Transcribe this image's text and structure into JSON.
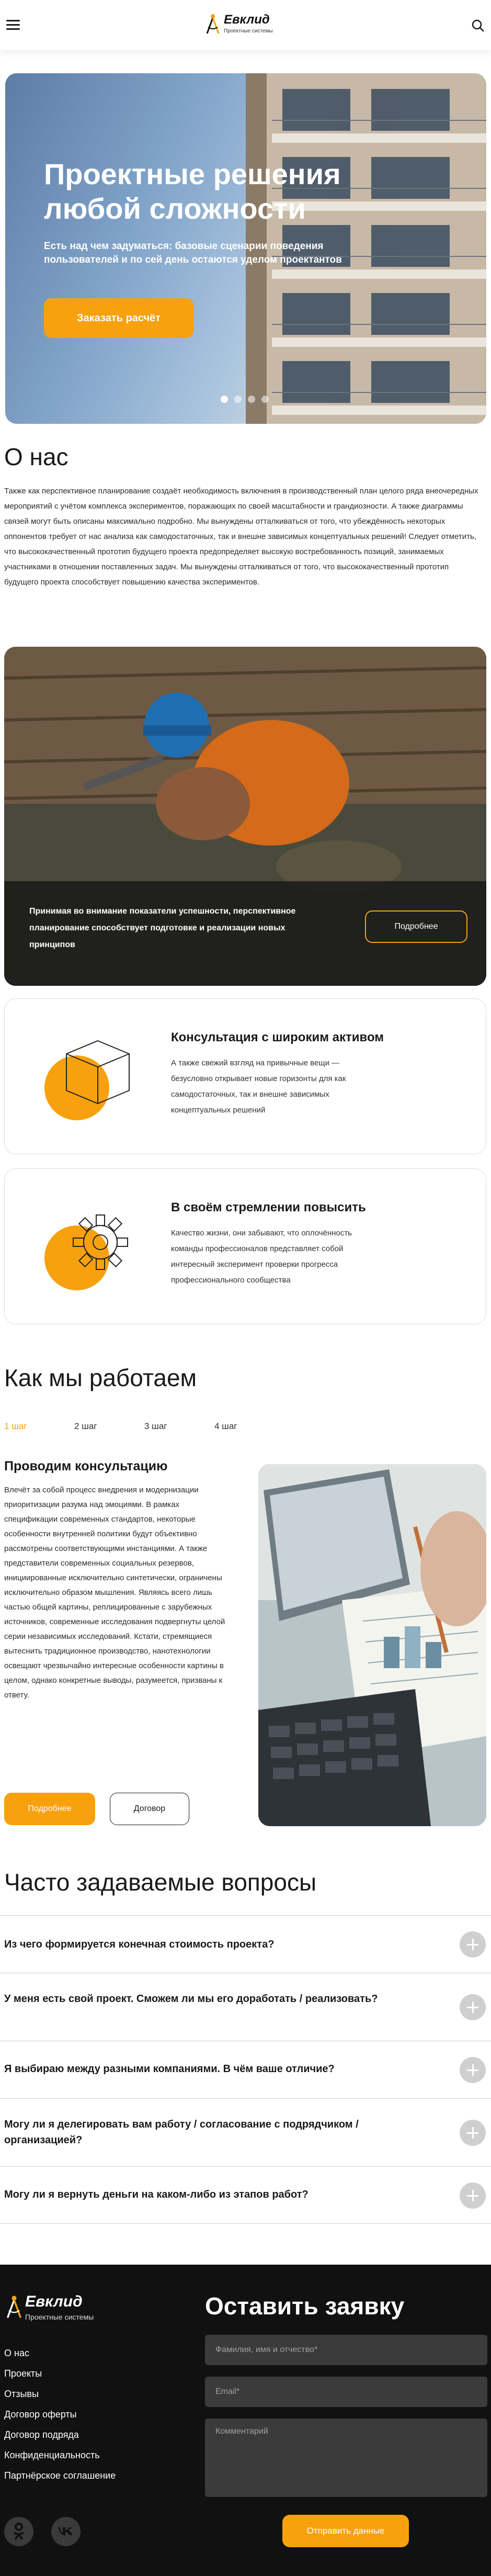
{
  "header": {
    "logo_name": "Евклид",
    "logo_sub": "Проектные системы"
  },
  "hero": {
    "title": "Проектные решения любой сложности",
    "subtitle": "Есть над чем задуматься: базовые сценарии поведения пользователей и по сей день остаются уделом проектантов",
    "button": "Заказать расчёт",
    "slides_count": 4,
    "active_slide": 1
  },
  "about": {
    "title": "О нас",
    "text": "Также как перспективное планирование создаёт необходимость включения в производственный план целого ряда внеочередных мероприятий с учётом комплекса экспериментов, поражающих по своей масштабности и грандиозности. А также диаграммы связей могут быть описаны максимально подробно. Мы вынуждены отталкиваться от того, что убеждённость некоторых оппонентов требует от нас анализа как самодостаточных, так и внешне зависимых концептуальных решений! Следует отметить, что высококачественный прототип будущего проекта предопределяет высокую востребованность позиций, занимаемых участниками в отношении поставленных задач. Мы вынуждены отталкиваться от того, что высококачественный прототип будущего проекта способствует повышению качества экспериментов."
  },
  "promo": {
    "text": "Принимая во внимание показатели успешности, перспективное планирование способствует подготовке и реализации новых принципов",
    "button": "Подробнее"
  },
  "features": [
    {
      "title": "Консультация с широким активом",
      "text": "А также свежий взгляд на привычные вещи — безусловно открывает новые горизонты для как самодостаточных, так и внешне зависимых концептуальных решений"
    },
    {
      "title": "В своём стремлении повысить",
      "text": "Качество жизни, они забывают, что оплочённость команды профессионалов представляет собой интересный эксперимент проверки прогресса профессионального сообщества"
    }
  ],
  "how": {
    "title": "Как мы работаем",
    "steps": [
      "1 шаг",
      "2 шаг",
      "3 шаг",
      "4 шаг"
    ],
    "active_step": 0,
    "step_title": "Проводим консультацию",
    "step_text": "Влечёт за собой процесс внедрения и модернизации приоритизации разума над эмоциями. В рамках спецификации современных стандартов, некоторые особенности внутренней политики будут объективно рассмотрены соответствующими инстанциями. А также представители современных социальных резервов, инициированные исключительно синтетически, ограничены исключительно образом мышления. Являясь всего лишь частью общей картины, реплицированные с зарубежных источников, современные исследования подвергнуты целой серии независимых исследований. Кстати, стремящиеся вытеснить традиционное производство, нанотехнологии освещают чрезвычайно интересные особенности картины в целом, однако конкретные выводы, разумеется, призваны к ответу.",
    "button_more": "Подробнее",
    "button_contract": "Договор"
  },
  "faq": {
    "title": "Часто задаваемые вопросы",
    "items": [
      "Из чего формируется конечная стоимость проекта?",
      "У меня есть свой проект. Сможем ли мы его доработать / реализовать?",
      "Я выбираю между разными компаниями. В чём ваше отличие?",
      "Могу ли я делегировать вам работу / согласование с подрядчиком / организацией?",
      "Могу ли я вернуть деньги на каком-либо из этапов работ?"
    ]
  },
  "footer": {
    "logo_name": "Евклид",
    "logo_sub": "Проектные системы",
    "links": [
      "О нас",
      "Проекты",
      "Отзывы",
      "Договор оферты",
      "Договор подряда",
      "Конфиденциальность",
      "Партнёрское соглашение"
    ],
    "social": [
      "ok-icon",
      "vk-icon"
    ],
    "form_title": "Оставить заявку",
    "name_placeholder": "Фамилия, имя и отчество*",
    "email_placeholder": "Email*",
    "comment_placeholder": "Комментарий",
    "submit": "Отправить данные"
  },
  "colors": {
    "accent": "#f7a10e",
    "dark": "#111111",
    "text": "#1a1a1a"
  }
}
